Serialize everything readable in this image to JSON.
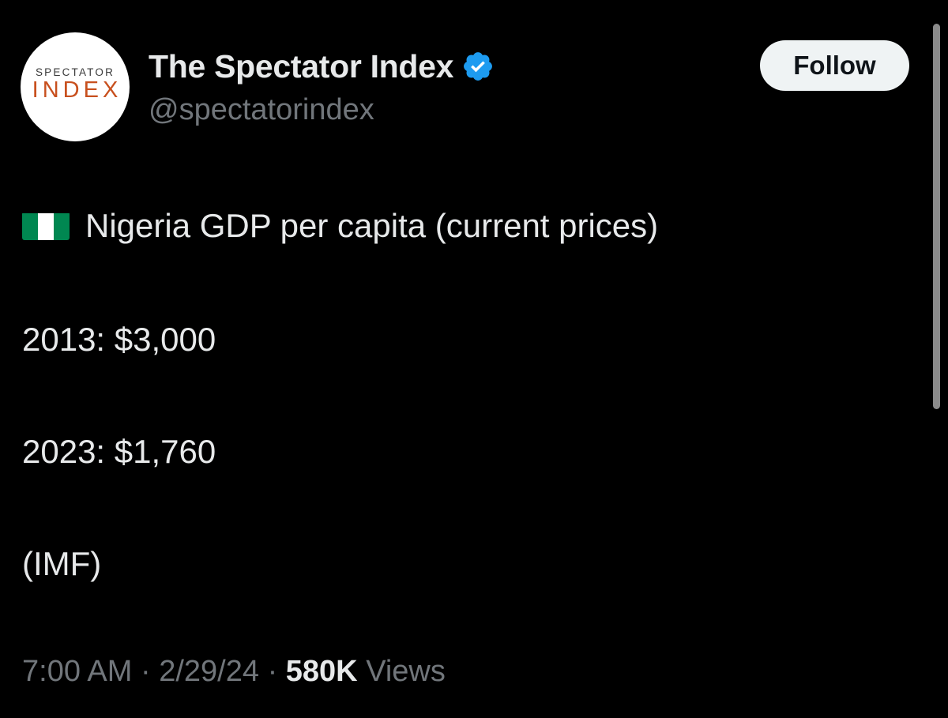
{
  "account": {
    "display_name": "The Spectator Index",
    "handle": "@spectatorindex",
    "avatar": {
      "logo_top": "SPECTATOR",
      "logo_bottom": "INDEX",
      "logo_top_color": "#3a3a3a",
      "logo_bottom_color": "#c8501e"
    },
    "verified_icon": "verified-badge-icon",
    "verified_color": "#1d9bf0"
  },
  "actions": {
    "follow_label": "Follow"
  },
  "tweet": {
    "flag_icon": "nigeria-flag-icon",
    "title": "Nigeria GDP per capita (current prices)",
    "line_2013": "2013: $3,000",
    "line_2023": "2023: $1,760",
    "source": "(IMF)"
  },
  "meta": {
    "time": "7:00 AM",
    "separator": "·",
    "date": "2/29/24",
    "views_count": "580K",
    "views_label": "Views"
  },
  "colors": {
    "background": "#000000",
    "text_primary": "#e7e9ea",
    "text_secondary": "#71767b",
    "follow_button_bg": "#eff3f4",
    "flag_green": "#008751"
  }
}
